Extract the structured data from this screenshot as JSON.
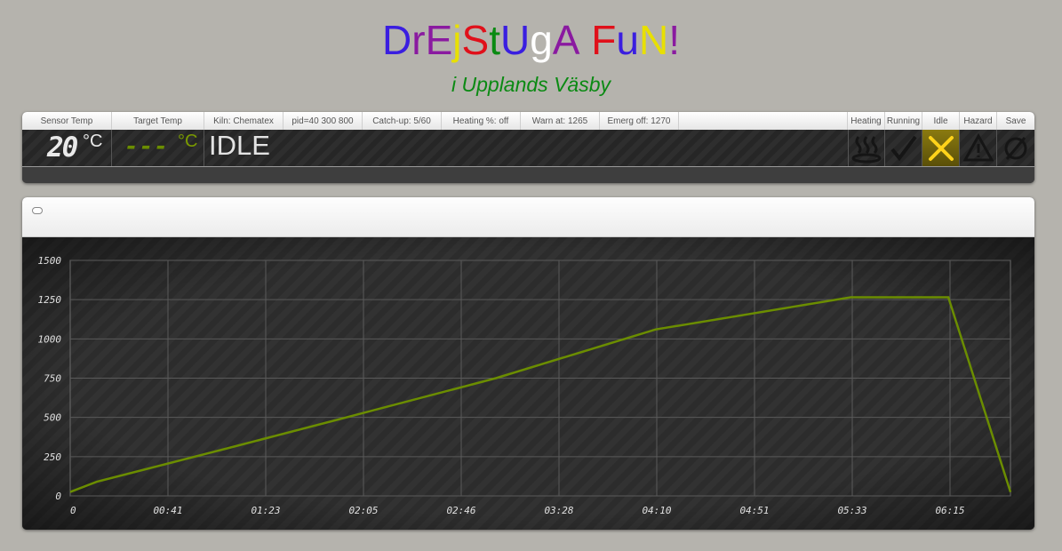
{
  "header": {
    "title_letters": [
      {
        "ch": "D",
        "color": "#3a1ee0"
      },
      {
        "ch": "r",
        "color": "#8a1aa0"
      },
      {
        "ch": "E",
        "color": "#8a1aa0"
      },
      {
        "ch": "j",
        "color": "#e8e000"
      },
      {
        "ch": "S",
        "color": "#e0101a"
      },
      {
        "ch": "t",
        "color": "#0a8a12"
      },
      {
        "ch": "U",
        "color": "#3a1ee0"
      },
      {
        "ch": "g",
        "color": "#ffffff"
      },
      {
        "ch": "A",
        "color": "#8a1aa0"
      },
      {
        "ch": " ",
        "color": "#000000"
      },
      {
        "ch": "F",
        "color": "#e0101a"
      },
      {
        "ch": "u",
        "color": "#3a1ee0"
      },
      {
        "ch": "N",
        "color": "#e8e000"
      },
      {
        "ch": "!",
        "color": "#8a1aa0"
      }
    ],
    "subtitle": "i Upplands Väsby"
  },
  "status": {
    "headers": {
      "sensor": "Sensor Temp",
      "target": "Target Temp",
      "kiln": "Kiln: Chematex",
      "pid": "pid=40 300 800",
      "catchup": "Catch-up: 5/60",
      "heating_pct": "Heating %: off",
      "warn": "Warn at: 1265",
      "emerg": "Emerg off: 1270",
      "heating": "Heating",
      "running": "Running",
      "idle": "Idle",
      "hazard": "Hazard",
      "save": "Save"
    },
    "sensor_value": "20",
    "sensor_unit": "°C",
    "target_value": "---",
    "target_unit": "°C",
    "state": "IDLE",
    "icons": {
      "heating": "heating-icon",
      "running": "checkmark-icon",
      "idle": "x-icon",
      "hazard": "hazard-icon",
      "save": "no-save-icon"
    },
    "active_indicator": "idle",
    "accent": "#ffd21a"
  },
  "chart_data": {
    "type": "line",
    "title": "",
    "xlabel": "",
    "ylabel": "",
    "ylim": [
      0,
      1500
    ],
    "yticks": [
      "0",
      "250",
      "500",
      "750",
      "1000",
      "1250",
      "1500"
    ],
    "xticks": [
      "0",
      "00:41",
      "01:23",
      "02:05",
      "02:46",
      "03:28",
      "04:10",
      "04:51",
      "05:33",
      "06:15"
    ],
    "x_minutes": [
      0,
      30,
      175,
      325,
      480,
      660,
      880,
      990,
      1060
    ],
    "y": [
      25,
      90,
      300,
      520,
      750,
      1060,
      1265,
      1265,
      25
    ],
    "x_max_minutes": 1060,
    "line_color": "#6b8d00",
    "grid": true
  }
}
